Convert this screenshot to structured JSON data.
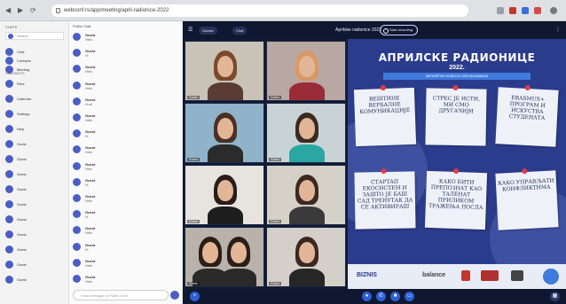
{
  "browser": {
    "address": "webconf.rs/app/meeting/april-radionice-2022",
    "nav_back": "◀",
    "nav_forward": "▶",
    "nav_reload": "⟳"
  },
  "rail": {
    "search": "Search",
    "section_chats": "CHATS",
    "section_contacts": "CONTACTS",
    "rows": [
      {
        "name": "Chat"
      },
      {
        "name": "Contacts"
      },
      {
        "name": "Meeting"
      },
      {
        "name": "Files"
      },
      {
        "name": "Calendar"
      },
      {
        "name": "Settings"
      },
      {
        "name": "Help"
      },
      {
        "name": "Guest"
      },
      {
        "name": "Guest"
      },
      {
        "name": "Guest"
      },
      {
        "name": "Guest"
      },
      {
        "name": "Guest"
      },
      {
        "name": "Guest"
      },
      {
        "name": "Guest"
      },
      {
        "name": "Guest"
      },
      {
        "name": "Guest"
      },
      {
        "name": "Guest"
      }
    ]
  },
  "chat": {
    "header": "Public Chat",
    "input_placeholder": "Send message to Public Chat",
    "messages": [
      {
        "name": "Guest",
        "text": "Hello"
      },
      {
        "name": "Guest",
        "text": "Hi"
      },
      {
        "name": "Guest",
        "text": "Hello"
      },
      {
        "name": "Guest",
        "text": "Hello"
      },
      {
        "name": "Guest",
        "text": "Hi all"
      },
      {
        "name": "Guest",
        "text": "Hello"
      },
      {
        "name": "Guest",
        "text": "Hi"
      },
      {
        "name": "Guest",
        "text": "Hello"
      },
      {
        "name": "Guest",
        "text": "Hello"
      },
      {
        "name": "Guest",
        "text": "Hi"
      },
      {
        "name": "Guest",
        "text": "Hello"
      },
      {
        "name": "Guest",
        "text": "Hi"
      },
      {
        "name": "Guest",
        "text": "Hello"
      },
      {
        "name": "Guest",
        "text": "Hi"
      },
      {
        "name": "Guest",
        "text": "Hello"
      },
      {
        "name": "Guest",
        "text": "Hello"
      }
    ]
  },
  "meeting": {
    "title": "Aprilske radionice 2022",
    "record": "Start recording",
    "pill_one": "Guests",
    "pill_two": "Chat",
    "tiles": [
      {
        "label": "Guest"
      },
      {
        "label": "Guest"
      },
      {
        "label": "Guest"
      },
      {
        "label": "Guest"
      },
      {
        "label": "Guest"
      },
      {
        "label": "Guest"
      },
      {
        "label": "Guest"
      },
      {
        "label": "Guest"
      }
    ]
  },
  "poster": {
    "title": "АПРИЛСКЕ РАДИОНИЦЕ",
    "year": "2022.",
    "subtitle": "КАРИЈЕРНИ РАЗВОЈ И ЗАПОШЉАВАЊЕ",
    "notes": [
      {
        "title": "ВЕШТИНЕ ВЕРБАЛНЕ КОМУНИКАЦИЈЕ",
        "speaker": "",
        "date": ""
      },
      {
        "title": "СТРЕС ЈЕ ИСТИ, МИ СМО ДРУГАЧИЈИ",
        "speaker": "",
        "date": ""
      },
      {
        "title": "ERASMUS+ ПРОГРАМ И ИСКУСТВА СТУДЕНАТА",
        "speaker": "",
        "date": ""
      },
      {
        "title": "СТАРТАП ЕКОСИСТЕМ И ЗАШТО ЈЕ БАШ САД ТРЕНУТАК ДА СЕ АКТИВИРАШ",
        "speaker": "",
        "date": ""
      },
      {
        "title": "КАКО БИТИ ПРЕПОЗНАТ КАО ТАЛЕНАТ ПРИЛИКОМ ТРАЖЕЊА ПОСЛА",
        "speaker": "",
        "date": ""
      },
      {
        "title": "КАКО УПРАВЉАТИ КОНФЛИКТИМА",
        "speaker": "",
        "date": ""
      }
    ],
    "logos": [
      "BIZNIS",
      "balance"
    ]
  },
  "colors": {
    "accent": "#4b5ec4",
    "poster_bg": "#2c3c8c",
    "stage_bg": "#101a33",
    "pin": "#e23a4a"
  }
}
